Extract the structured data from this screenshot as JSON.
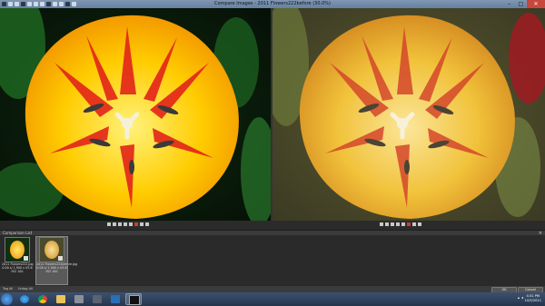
{
  "window": {
    "title": "Compare Images - 2011 Flowers222before (30.0%)"
  },
  "toolbar": {
    "icons": [
      "zoom-icon",
      "hand-icon",
      "pin-icon",
      "eyedropper-icon",
      "menu-icon",
      "fit-icon",
      "single-view-icon",
      "split-view-icon",
      "grid-icon",
      "lock-icon",
      "sync-icon",
      "info-icon"
    ]
  },
  "window_controls": {
    "minimize": "–",
    "maximize": "□",
    "close": "✕"
  },
  "comparison_list": {
    "header": "Comparison List",
    "close_glyph": "×",
    "items": [
      {
        "name": "2011 Flowers222.jpg",
        "meta": "0.00 s/ 1,900 x f/5.6",
        "iso": "ISO 100"
      },
      {
        "name": "2011 Flowers222before.jpg",
        "meta": "0.00 s/ 1,900 x f/5.6",
        "iso": "ISO 100"
      }
    ]
  },
  "bottom": {
    "tag_all": "Tag All",
    "untag_all": "Untag All",
    "ok": "OK",
    "cancel": "Cancel"
  },
  "taskbar": {
    "time": "4:31 PM",
    "date": "10/5/2011"
  },
  "colors": {
    "title_bar": "#6f89aa",
    "background": "#2b2b2b",
    "close_red": "#c9463d"
  }
}
